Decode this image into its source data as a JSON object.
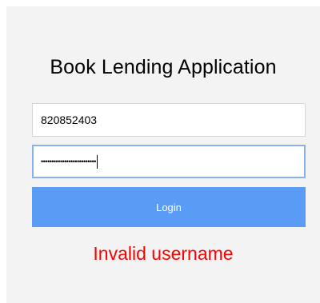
{
  "app": {
    "title": "Book Lending Application"
  },
  "form": {
    "username_value": "820852403",
    "password_masked": "••••••••••••••••••••••••••",
    "login_label": "Login",
    "error_message": "Invalid username"
  },
  "colors": {
    "login_button": "#5a9bf5",
    "error": "#ff0000",
    "focus_border": "#8ab2ea"
  }
}
